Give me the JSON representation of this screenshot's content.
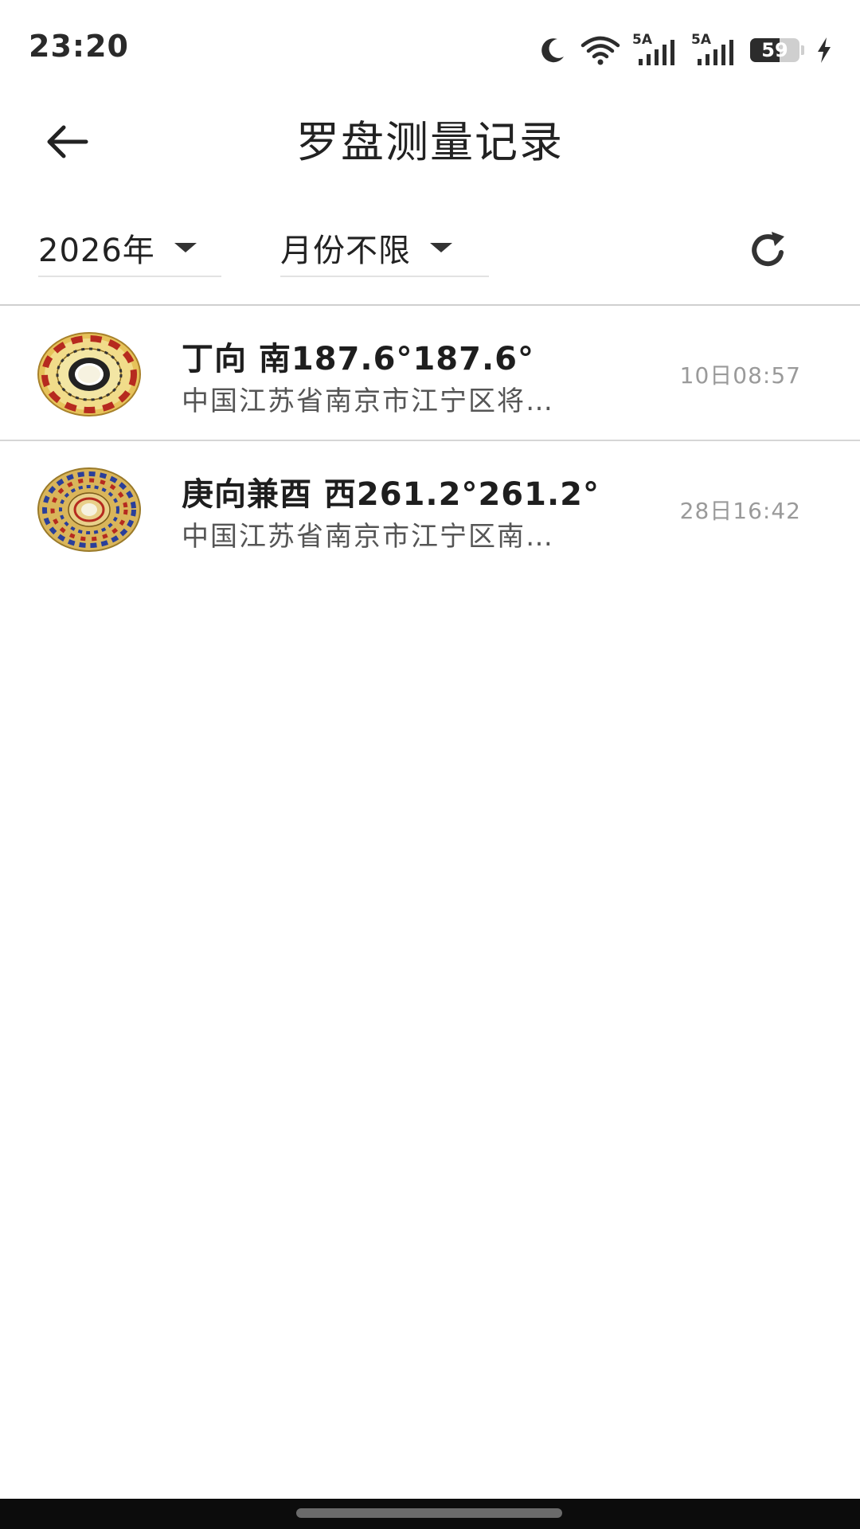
{
  "status_bar": {
    "time": "23:20",
    "battery_level": "59",
    "signal1_label": "5A",
    "signal2_label": "5A"
  },
  "app_bar": {
    "title": "罗盘测量记录",
    "back_icon": "arrow-left-icon"
  },
  "filters": {
    "year": "2026年",
    "month": "月份不限",
    "refresh_icon": "refresh-icon"
  },
  "records": [
    {
      "title": "丁向 南187.6°187.6°",
      "address": "中国江苏省南京市江宁区将…",
      "time": "10日08:57"
    },
    {
      "title": "庚向兼酉 西261.2°261.2°",
      "address": "中国江苏省南京市江宁区南…",
      "time": "28日16:42"
    }
  ]
}
